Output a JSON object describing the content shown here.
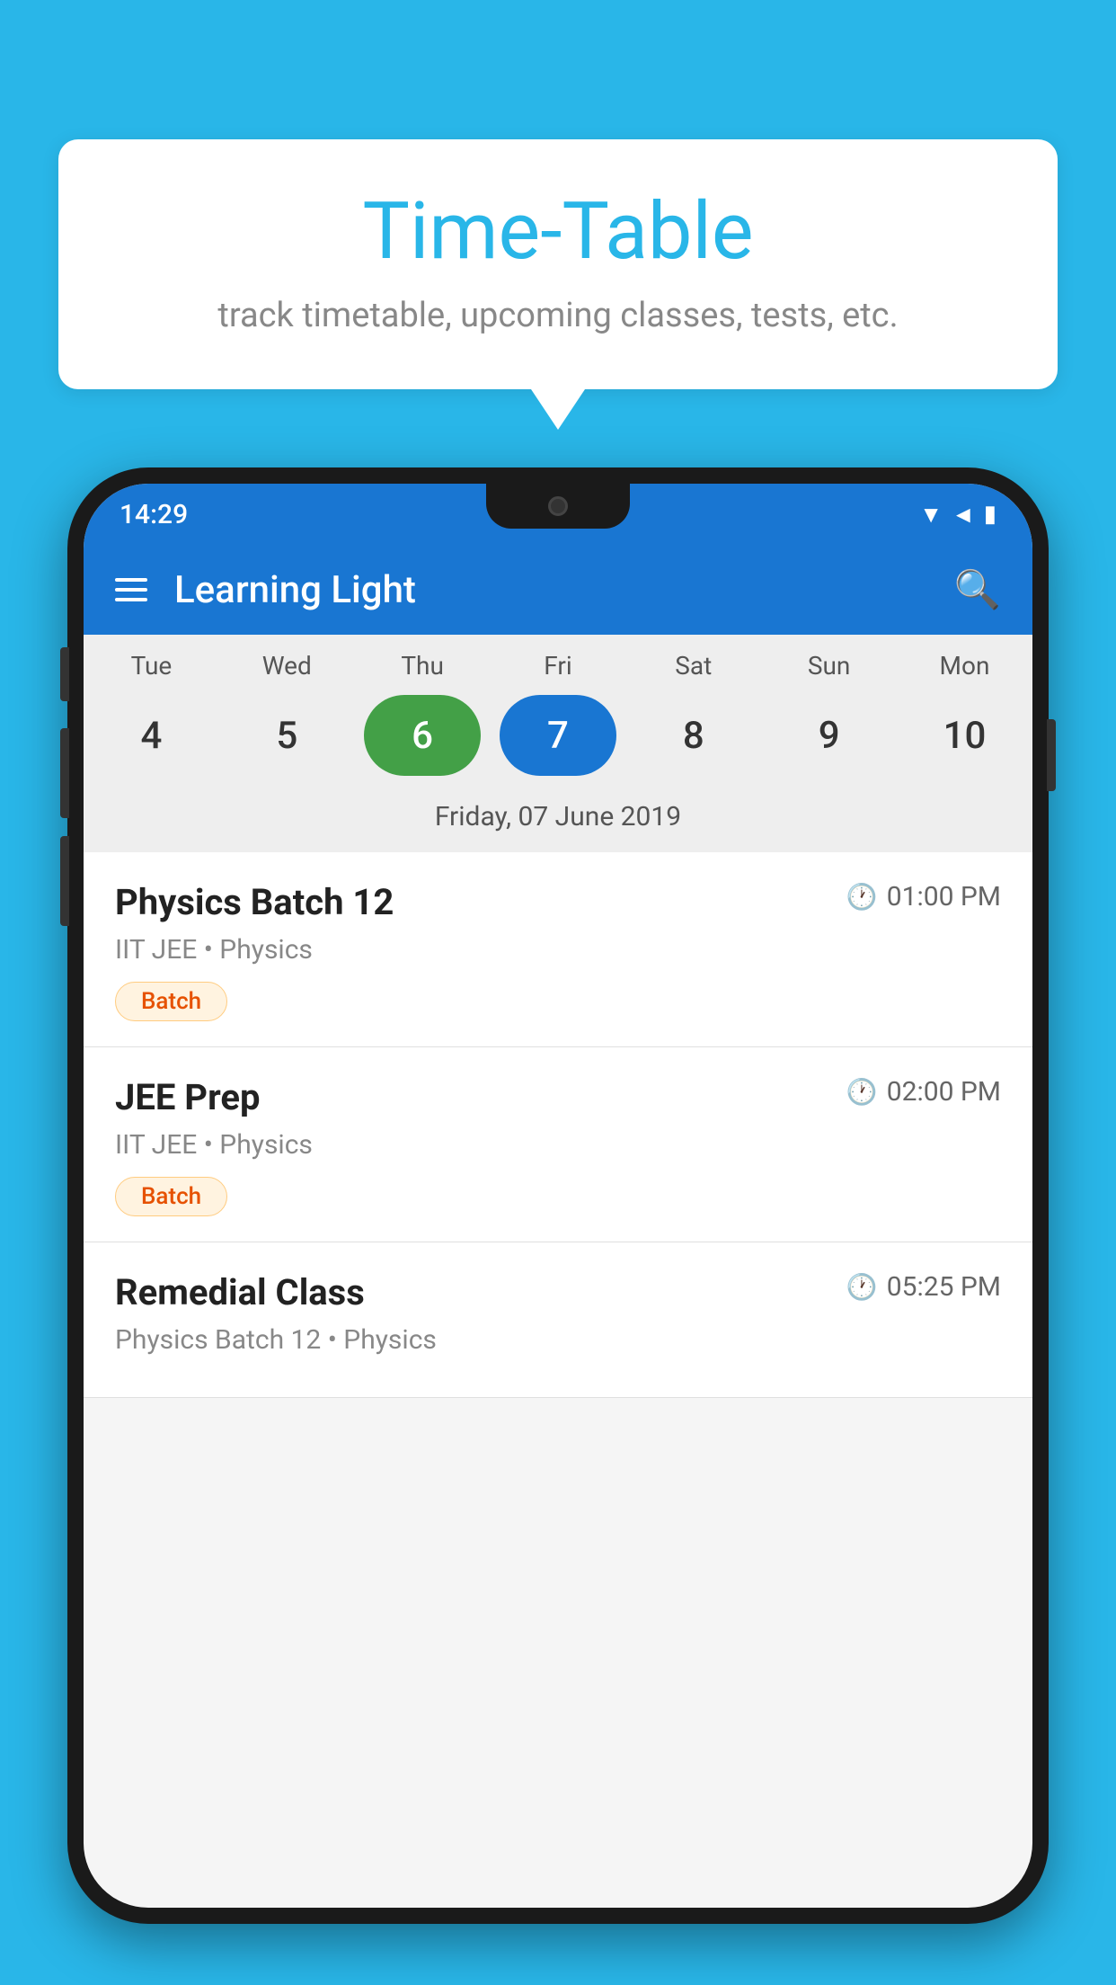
{
  "background_color": "#29B6E8",
  "bubble": {
    "title": "Time-Table",
    "subtitle": "track timetable, upcoming classes, tests, etc."
  },
  "phone": {
    "status_bar": {
      "time": "14:29"
    },
    "app_bar": {
      "title": "Learning Light"
    },
    "calendar": {
      "days": [
        "Tue",
        "Wed",
        "Thu",
        "Fri",
        "Sat",
        "Sun",
        "Mon"
      ],
      "dates": [
        "4",
        "5",
        "6",
        "7",
        "8",
        "9",
        "10"
      ],
      "today_index": 2,
      "selected_index": 3,
      "selected_label": "Friday, 07 June 2019"
    },
    "schedule": [
      {
        "title": "Physics Batch 12",
        "time": "01:00 PM",
        "subtitle": "IIT JEE • Physics",
        "badge": "Batch"
      },
      {
        "title": "JEE Prep",
        "time": "02:00 PM",
        "subtitle": "IIT JEE • Physics",
        "badge": "Batch"
      },
      {
        "title": "Remedial Class",
        "time": "05:25 PM",
        "subtitle": "Physics Batch 12 • Physics",
        "badge": null
      }
    ]
  }
}
